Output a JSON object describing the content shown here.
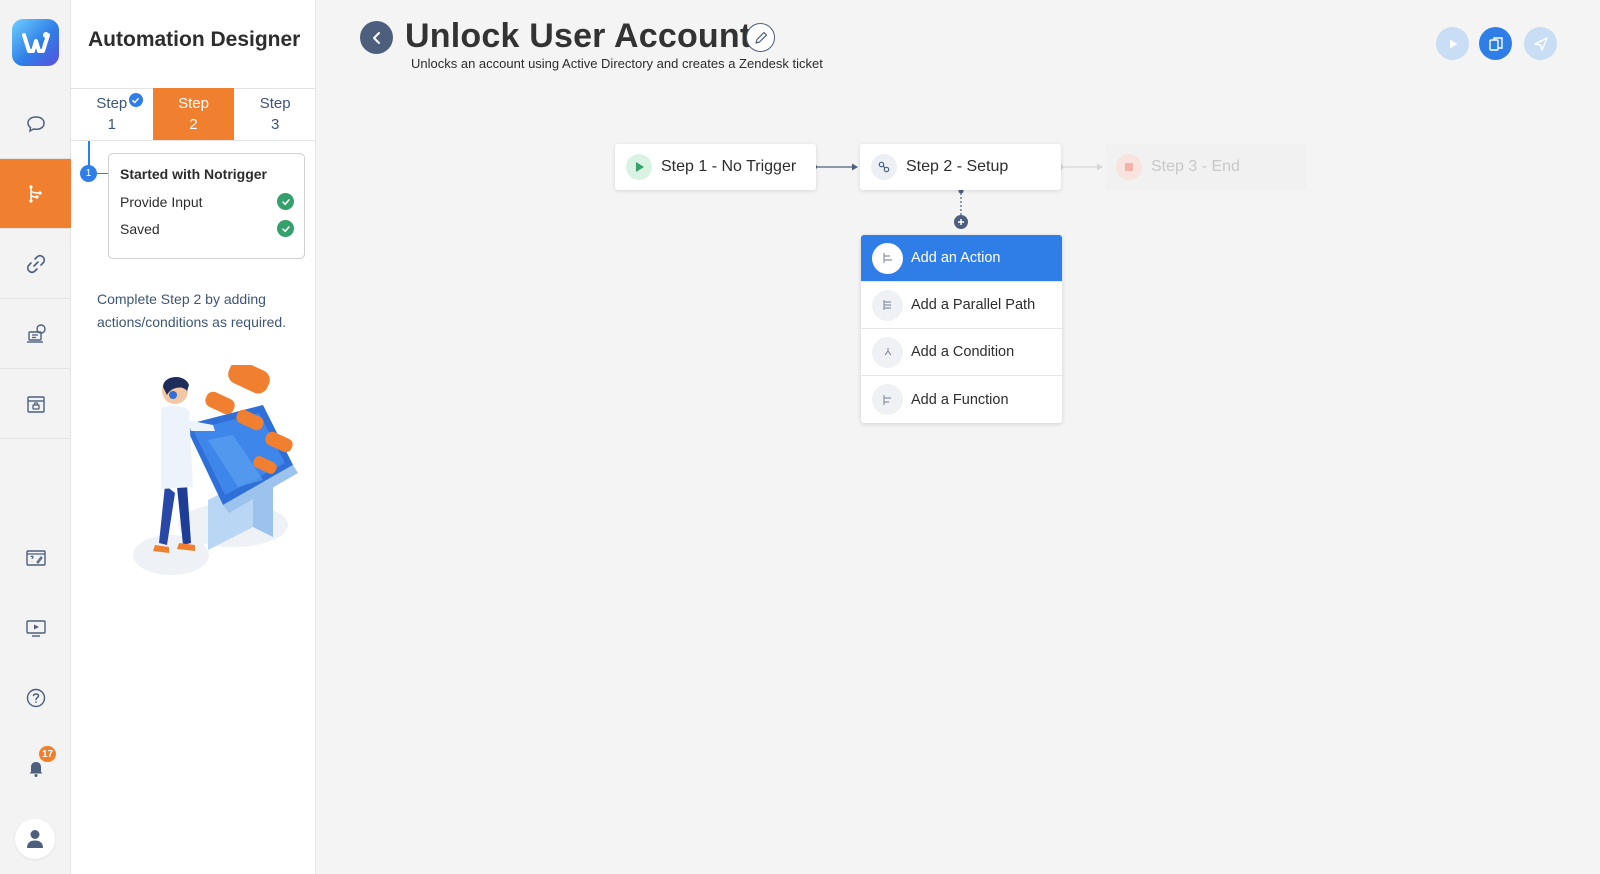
{
  "app": {
    "panel_title": "Automation Designer"
  },
  "rail": {
    "items": [
      {
        "name": "chat-icon"
      },
      {
        "name": "workflow-icon",
        "active": true
      },
      {
        "name": "link-icon"
      },
      {
        "name": "bot-support-icon"
      },
      {
        "name": "store-icon"
      }
    ],
    "lower_items": [
      {
        "name": "form-icon"
      },
      {
        "name": "video-icon"
      },
      {
        "name": "help-icon"
      },
      {
        "name": "bell-icon"
      }
    ],
    "notification_count": "17"
  },
  "steps": {
    "tabs": [
      {
        "label": "Step",
        "number": "1",
        "completed": true
      },
      {
        "label": "Step",
        "number": "2",
        "active": true
      },
      {
        "label": "Step",
        "number": "3"
      }
    ],
    "timeline_index": "1"
  },
  "status_card": {
    "title": "Started with Notrigger",
    "rows": [
      {
        "label": "Provide Input"
      },
      {
        "label": "Saved"
      }
    ]
  },
  "hint": "Complete Step 2 by adding actions/conditions as required.",
  "header": {
    "title": "Unlock User Account",
    "subtitle": "Unlocks an account using Active Directory and creates a Zendesk ticket"
  },
  "canvas": {
    "nodes": [
      {
        "label": "Step 1 - No Trigger"
      },
      {
        "label": "Step 2 - Setup"
      },
      {
        "label": "Step 3 - End",
        "disabled": true
      }
    ],
    "menu": [
      {
        "label": "Add an Action",
        "active": true
      },
      {
        "label": "Add a Parallel Path"
      },
      {
        "label": "Add a Condition"
      },
      {
        "label": "Add a Function"
      }
    ]
  },
  "colors": {
    "accent": "#f08030",
    "primary": "#2f7ee8",
    "success": "#34a06b",
    "slate": "#4d5f7c"
  }
}
